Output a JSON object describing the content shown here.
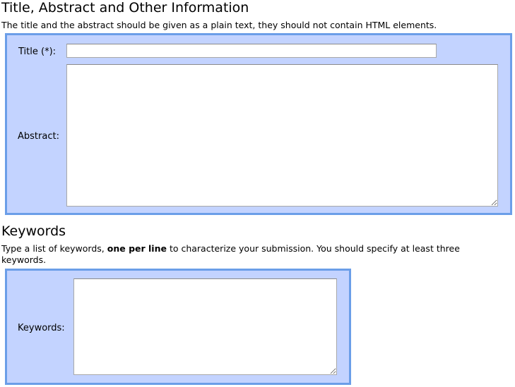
{
  "title_section": {
    "heading": "Title, Abstract and Other Information",
    "description": "The title and the abstract should be given as a plain text, they should not contain HTML elements.",
    "title_label": "Title (*):",
    "title_value": "",
    "abstract_label": "Abstract:",
    "abstract_value": ""
  },
  "keywords_section": {
    "heading": "Keywords",
    "description_before": "Type a list of keywords, ",
    "description_bold": "one per line",
    "description_after": " to characterize your submission. You should specify at least three keywords.",
    "keywords_label": "Keywords:",
    "keywords_value": ""
  },
  "colors": {
    "panel_background": "#c3d3ff",
    "panel_border": "#6b9ee8"
  }
}
